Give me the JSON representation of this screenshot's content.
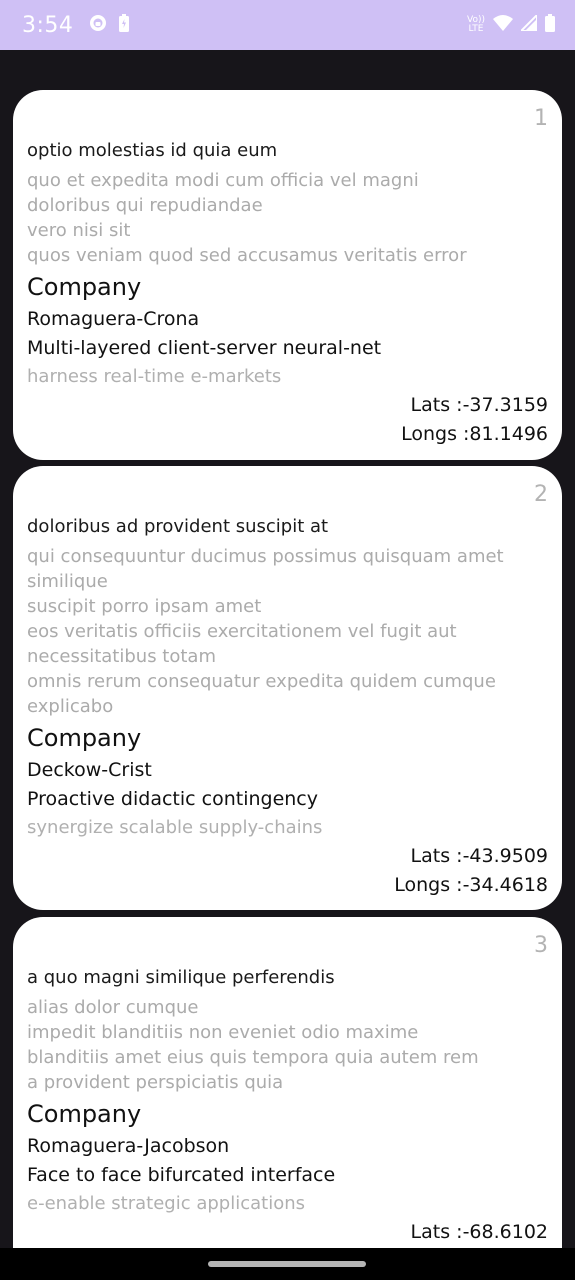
{
  "status_bar": {
    "time": "3:54",
    "network_label_top": "Vo))",
    "network_label_bottom": "LTE",
    "background_color": "#cfc0f5"
  },
  "posts": [
    {
      "id": "1",
      "title": "optio molestias id quia eum",
      "body_lines": [
        "quo et expedita modi cum officia vel magni",
        "doloribus qui repudiandae",
        "vero nisi sit",
        "quos veniam quod sed accusamus veritatis error"
      ],
      "company_heading": "Company",
      "company_name": "Romaguera-Crona",
      "catch_phrase": "Multi-layered client-server neural-net",
      "bs": "harness real-time e-markets",
      "lat_label": "Lats :-37.3159",
      "lng_label": "Longs :81.1496"
    },
    {
      "id": "2",
      "title": "doloribus ad provident suscipit at",
      "body_lines": [
        "qui consequuntur ducimus possimus quisquam amet",
        "similique",
        "suscipit porro ipsam amet",
        "eos veritatis officiis exercitationem vel fugit aut",
        "necessitatibus totam",
        "omnis rerum consequatur expedita quidem cumque",
        "explicabo"
      ],
      "company_heading": "Company",
      "company_name": "Deckow-Crist",
      "catch_phrase": "Proactive didactic contingency",
      "bs": "synergize scalable supply-chains",
      "lat_label": "Lats :-43.9509",
      "lng_label": "Longs :-34.4618"
    },
    {
      "id": "3",
      "title": "a quo magni similique perferendis",
      "body_lines": [
        "alias dolor cumque",
        "impedit blanditiis non eveniet odio maxime",
        "blanditiis amet eius quis tempora quia autem rem",
        "a provident perspiciatis quia"
      ],
      "company_heading": "Company",
      "company_name": "Romaguera-Jacobson",
      "catch_phrase": "Face to face bifurcated interface",
      "bs": "e-enable strategic applications",
      "lat_label": "Lats :-68.6102"
    }
  ]
}
